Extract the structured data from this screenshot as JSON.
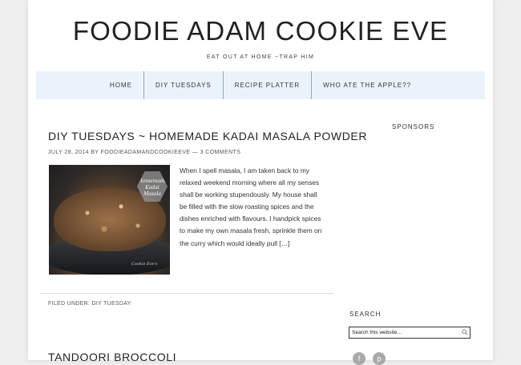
{
  "site": {
    "title": "FOODIE ADAM COOKIE EVE",
    "tagline": "EAT OUT AT HOME ~TRAP HIM"
  },
  "nav": {
    "items": [
      {
        "label": "HOME"
      },
      {
        "label": "DIY TUESDAYS"
      },
      {
        "label": "RECIPE PLATTER"
      },
      {
        "label": "WHO ATE THE APPLE??"
      }
    ],
    "background": "#eaf3fb"
  },
  "post": {
    "title": "DIY TUESDAYS ~ HOMEMADE KADAI MASALA POWDER",
    "date": "JULY 28, 2014",
    "by": "BY",
    "author": "FOODIEADAMANDCOOKIEEVE",
    "dash": "—",
    "comments": "3 COMMENTS",
    "image": {
      "badge_text": "Homemade Kadai Masala",
      "watermark": "Cookie Eve's"
    },
    "excerpt": "When I spell masala, I am taken back to my relaxed weekend morning where all my senses shall be working stupendously.  My house shall be filled with the slow roasting spices and the dishes enriched with flavours. I handpick spices to make my own masala fresh, sprinkle them on the curry which would ideally pull",
    "more": "[…]",
    "filed_label": "FILED UNDER:",
    "category": "DIY TUESDAY"
  },
  "next_post": {
    "title": "TANDOORI BROCCOLI"
  },
  "sidebar": {
    "sponsors_heading": "SPONSORS",
    "search_heading": "SEARCH",
    "search_placeholder": "Search this website…",
    "social_icons": [
      "facebook-icon",
      "pinterest-icon"
    ]
  }
}
